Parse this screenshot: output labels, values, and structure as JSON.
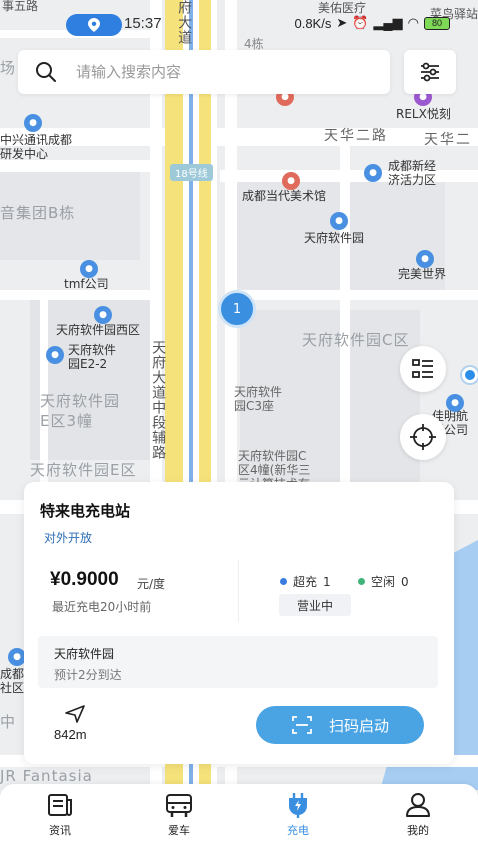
{
  "status_bar": {
    "time": "15:37",
    "network_speed": "0.8K/s",
    "battery": "80"
  },
  "search": {
    "placeholder": "请输入搜索内容"
  },
  "map": {
    "labels": {
      "top_left": "事五路",
      "meiyou": "美佑医疗",
      "cainiao": "菜鸟驿站",
      "building4": "4栋",
      "chang": "场",
      "relx": "RELX悦刻",
      "zhongxing": "中兴通讯成都\n研发中心",
      "tianhua2": "天华二路",
      "tianhua2b": "天华二",
      "metro": "18号线",
      "chengdu_new": "成都新经\n济活力区",
      "art_museum": "成都当代美术馆",
      "jituan": "音集团B栋",
      "tfsoft": "天府软件园",
      "wanmei": "完美世界",
      "tmf": "tmf公司",
      "tfsoft_west": "天府软件园西区",
      "tfsoft_e22": "天府软件\n园E2-2",
      "tfsoft_c": "天府软件园C区",
      "tfsoft_e3": "天府软件园\nE区3幢",
      "tfsoft_c3": "天府软件\n园C3座",
      "tfsoft_e": "天府软件园E区",
      "tfsoft_c4": "天府软件园C\n区4幢(新华三\n云计算技术有",
      "avenue_vertical": "天府大道中段辅路",
      "avenue_top": "府大道",
      "jiaming": "佳明航\n限公司",
      "fantasia": "JR Fantasia",
      "left_mid": "成都\n社区",
      "left_mid2": "中",
      "cluster_count": "1"
    }
  },
  "station": {
    "name": "特来电充电站",
    "open_status": "对外开放",
    "price": "¥0.9000",
    "price_unit": "元/度",
    "last_charge": "最近充电20小时前",
    "fast_charge_label": "超充",
    "fast_charge_count": "1",
    "idle_label": "空闲",
    "idle_count": "0",
    "business_status": "营业中",
    "destination": "天府软件园",
    "eta": "预计2分到达",
    "distance": "842m",
    "scan_button": "扫码启动",
    "colors": {
      "fast": "#3a7be0",
      "idle": "#3fb37a",
      "button": "#4aa4e4"
    }
  },
  "tabs": [
    {
      "label": "资讯",
      "icon": "news-icon"
    },
    {
      "label": "爱车",
      "icon": "car-icon"
    },
    {
      "label": "充电",
      "icon": "charge-plug-icon",
      "active": true
    },
    {
      "label": "我的",
      "icon": "profile-icon"
    }
  ]
}
